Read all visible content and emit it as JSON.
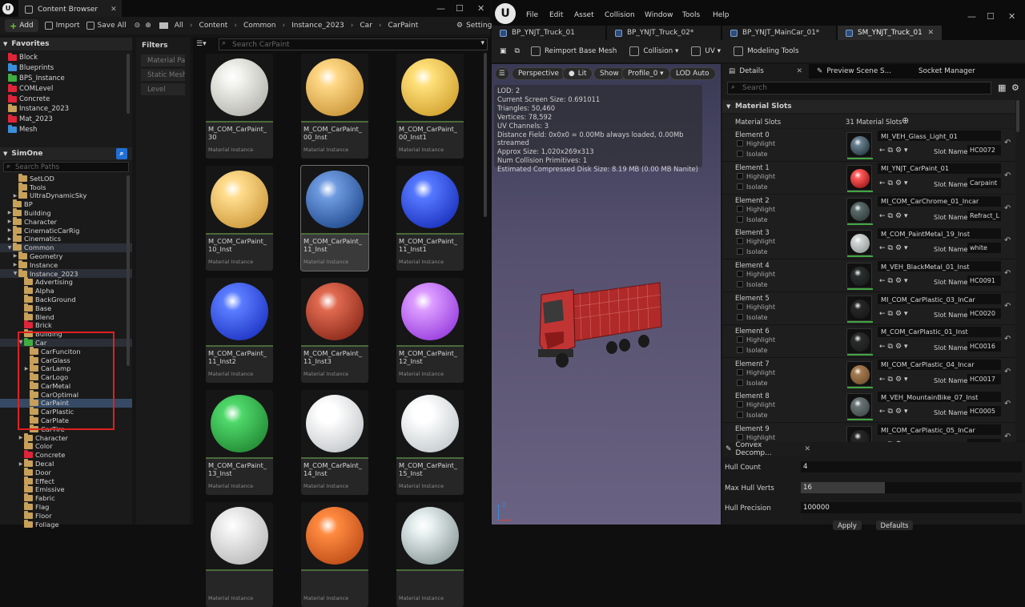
{
  "cb": {
    "title": "Content Browser",
    "add_label": "Add",
    "import_label": "Import",
    "saveall_label": "Save All",
    "settings_label": "Settings",
    "breadcrumb": [
      "All",
      "Content",
      "Common",
      "Instance_2023",
      "Car",
      "CarPaint"
    ],
    "favorites_header": "Favorites",
    "favorites": [
      {
        "label": "Block",
        "color": "#e0243a"
      },
      {
        "label": "Blueprints",
        "color": "#3b8ed8"
      },
      {
        "label": "BPS_Instance",
        "color": "#3fae3f"
      },
      {
        "label": "COMLevel",
        "color": "#e0243a"
      },
      {
        "label": "Concrete",
        "color": "#e0243a"
      },
      {
        "label": "Instance_2023",
        "color": "#c7a05a"
      },
      {
        "label": "Mat_2023",
        "color": "#e0243a"
      },
      {
        "label": "Mesh",
        "color": "#3b8ed8"
      }
    ],
    "tree_header": "SimOne",
    "search_paths": "Search Paths",
    "tree": [
      {
        "label": "SetLOD",
        "d": 3,
        "c": "#c7a05a"
      },
      {
        "label": "Tools",
        "d": 3,
        "c": "#c7a05a"
      },
      {
        "label": "UltraDynamicSky",
        "d": 3,
        "c": "#c7a05a",
        "a": "▶"
      },
      {
        "label": "BP",
        "d": 2,
        "c": "#c7a05a"
      },
      {
        "label": "Building",
        "d": 2,
        "c": "#c7a05a",
        "a": "▶"
      },
      {
        "label": "Character",
        "d": 2,
        "c": "#c7a05a",
        "a": "▶"
      },
      {
        "label": "CinematicCarRig",
        "d": 2,
        "c": "#c7a05a",
        "a": "▶"
      },
      {
        "label": "Cinematics",
        "d": 2,
        "c": "#c7a05a",
        "a": "▶"
      },
      {
        "label": "Common",
        "d": 2,
        "c": "#c7a05a",
        "a": "▼",
        "hl": true
      },
      {
        "label": "Geometry",
        "d": 3,
        "c": "#c7a05a",
        "a": "▶"
      },
      {
        "label": "Instance",
        "d": 3,
        "c": "#c7a05a",
        "a": "▶"
      },
      {
        "label": "Instance_2023",
        "d": 3,
        "c": "#c7a05a",
        "a": "▼",
        "hl": true
      },
      {
        "label": "Advertising",
        "d": 4,
        "c": "#c7a05a"
      },
      {
        "label": "Alpha",
        "d": 4,
        "c": "#c7a05a"
      },
      {
        "label": "BackGround",
        "d": 4,
        "c": "#c7a05a"
      },
      {
        "label": "Base",
        "d": 4,
        "c": "#c7a05a"
      },
      {
        "label": "Blend",
        "d": 4,
        "c": "#c7a05a"
      },
      {
        "label": "Brick",
        "d": 4,
        "c": "#e0243a"
      },
      {
        "label": "Building",
        "d": 4,
        "c": "#c7a05a"
      },
      {
        "label": "Car",
        "d": 4,
        "c": "#3fae3f",
        "a": "▼",
        "hl": true
      },
      {
        "label": "CarFunciton",
        "d": 5,
        "c": "#c7a05a"
      },
      {
        "label": "CarGlass",
        "d": 5,
        "c": "#c7a05a"
      },
      {
        "label": "CarLamp",
        "d": 5,
        "c": "#c7a05a",
        "a": "▶"
      },
      {
        "label": "CarLogo",
        "d": 5,
        "c": "#c7a05a"
      },
      {
        "label": "CarMetal",
        "d": 5,
        "c": "#c7a05a"
      },
      {
        "label": "CarOptimal",
        "d": 5,
        "c": "#c7a05a"
      },
      {
        "label": "CarPaint",
        "d": 5,
        "c": "#c7a05a",
        "sel": true
      },
      {
        "label": "CarPlastic",
        "d": 5,
        "c": "#c7a05a"
      },
      {
        "label": "CarPlate",
        "d": 5,
        "c": "#c7a05a"
      },
      {
        "label": "CarTire",
        "d": 5,
        "c": "#c7a05a"
      },
      {
        "label": "Character",
        "d": 4,
        "c": "#c7a05a",
        "a": "▶"
      },
      {
        "label": "Color",
        "d": 4,
        "c": "#c7a05a"
      },
      {
        "label": "Concrete",
        "d": 4,
        "c": "#e0243a"
      },
      {
        "label": "Decal",
        "d": 4,
        "c": "#c7a05a",
        "a": "▶"
      },
      {
        "label": "Door",
        "d": 4,
        "c": "#c7a05a"
      },
      {
        "label": "Effect",
        "d": 4,
        "c": "#c7a05a"
      },
      {
        "label": "Emissive",
        "d": 4,
        "c": "#c7a05a"
      },
      {
        "label": "Fabric",
        "d": 4,
        "c": "#c7a05a"
      },
      {
        "label": "Flag",
        "d": 4,
        "c": "#c7a05a"
      },
      {
        "label": "Floor",
        "d": 4,
        "c": "#c7a05a"
      },
      {
        "label": "Foliage",
        "d": 4,
        "c": "#c7a05a"
      }
    ],
    "filters_header": "Filters",
    "filter_chips": [
      "Material Pa",
      "Static Mesh",
      "Level"
    ],
    "grid_search": "Search CarPaint",
    "type_label": "Material Instance",
    "assets": [
      {
        "name": "M_COM_CarPaint_30",
        "c1": "#f2f2ee",
        "c2": "#a8a8a0"
      },
      {
        "name": "M_COM_CarPaint_00_Inst",
        "c1": "#ffd886",
        "c2": "#c08a2a"
      },
      {
        "name": "M_COM_CarPaint_00_Inst1",
        "c1": "#ffe07a",
        "c2": "#c89520"
      },
      {
        "name": "M_COM_CarPaint_10_Inst",
        "c1": "#ffdc8c",
        "c2": "#c48d2e"
      },
      {
        "name": "M_COM_CarPaint_11_Inst",
        "c1": "#6e9ae0",
        "c2": "#143d80",
        "sel": true
      },
      {
        "name": "M_COM_CarPaint_11_Inst1",
        "c1": "#5578ff",
        "c2": "#1024b0"
      },
      {
        "name": "M_COM_CarPaint_11_Inst2",
        "c1": "#5a7cff",
        "c2": "#1226b8"
      },
      {
        "name": "M_COM_CarPaint_11_Inst3",
        "c1": "#e06a50",
        "c2": "#7a1c10"
      },
      {
        "name": "M_COM_CarPaint_12_Inst",
        "c1": "#dc9cff",
        "c2": "#8a2ad8"
      },
      {
        "name": "M_COM_CarPaint_13_Inst",
        "c1": "#4fd86a",
        "c2": "#1a7a2a"
      },
      {
        "name": "M_COM_CarPaint_14_Inst",
        "c1": "#ffffff",
        "c2": "#b8bcc0"
      },
      {
        "name": "M_COM_CarPaint_15_Inst",
        "c1": "#ffffff",
        "c2": "#b8c0c4"
      },
      {
        "name": "",
        "c1": "#f0f0f0",
        "c2": "#b0b0b0"
      },
      {
        "name": "",
        "c1": "#ff8a40",
        "c2": "#b04010"
      },
      {
        "name": "",
        "c1": "#e8f0f0",
        "c2": "#7a8a8a"
      }
    ]
  },
  "editor": {
    "menus": [
      "File",
      "Edit",
      "Asset",
      "Collision",
      "Window",
      "Tools",
      "Help"
    ],
    "tabs": [
      "BP_YNJT_Truck_01",
      "BP_YNJT_Truck_02*",
      "BP_YNJT_MainCar_01*",
      "SM_YNJT_Truck_01"
    ],
    "toolbar": {
      "reimport": "Reimport Base Mesh",
      "collision": "Collision",
      "uv": "UV",
      "modeling": "Modeling Tools"
    },
    "viewport": {
      "perspective": "Perspective",
      "lit": "Lit",
      "show": "Show",
      "profile": "Profile_0",
      "lod_auto": "LOD Auto",
      "stats": [
        "LOD:  2",
        "Current Screen Size:  0.691011",
        "Triangles:  50,460",
        "Vertices:  78,592",
        "UV Channels:  3",
        "Distance Field:  0x0x0 = 0.00Mb always loaded, 0.00Mb streamed",
        "Approx Size: 1,020x269x313",
        "Num Collision Primitives:  1",
        "Estimated Compressed Disk Size: 8.19 MB (0.00 MB Nanite)"
      ]
    },
    "details": {
      "tabs": [
        "Details",
        "Preview Scene S...",
        "Socket Manager"
      ],
      "search": "Search",
      "section": "Material Slots",
      "slots_label": "Material Slots",
      "slots_count": "31 Material Slots",
      "highlight": "Highlight",
      "isolate": "Isolate",
      "slot_name_label": "Slot Name",
      "elements": [
        {
          "label": "Element 0",
          "mat": "MI_VEH_Glass_Light_01",
          "slot": "HC0072",
          "c1": "#6a8090",
          "c2": "#1a2a30"
        },
        {
          "label": "Element 1",
          "mat": "MI_YNJT_CarPaint_01",
          "slot": "Carpaint",
          "c1": "#ff5a5a",
          "c2": "#8a0a0a"
        },
        {
          "label": "Element 2",
          "mat": "MI_COM_CarChrome_01_Incar",
          "slot": "Refract_L",
          "c1": "#5a6a6a",
          "c2": "#2a3434"
        },
        {
          "label": "Element 3",
          "mat": "M_COM_PaintMetal_19_Inst",
          "slot": "white",
          "c1": "#d0d4d4",
          "c2": "#8a9090"
        },
        {
          "label": "Element 4",
          "mat": "M_VEH_BlackMetal_01_Inst",
          "slot": "HC0091",
          "c1": "#2a2e2e",
          "c2": "#161818"
        },
        {
          "label": "Element 5",
          "mat": "MI_COM_CarPlastic_03_InCar",
          "slot": "HC0020",
          "c1": "#262626",
          "c2": "#161616"
        },
        {
          "label": "Element 6",
          "mat": "M_COM_CarPlastic_01_Inst",
          "slot": "HC0016",
          "c1": "#2a2c2c",
          "c2": "#171818"
        },
        {
          "label": "Element 7",
          "mat": "MI_COM_CarPlastic_04_Incar",
          "slot": "HC0017",
          "c1": "#a47a50",
          "c2": "#6a4a2a"
        },
        {
          "label": "Element 8",
          "mat": "M_VEH_MountainBike_07_Inst",
          "slot": "HC0005",
          "c1": "#6a7474",
          "c2": "#3a4242"
        },
        {
          "label": "Element 9",
          "mat": "MI_COM_CarPlastic_05_InCar",
          "slot": "",
          "c1": "#262626",
          "c2": "#161616"
        }
      ]
    },
    "convex": {
      "title": "Convex Decomp...",
      "hull_count_label": "Hull Count",
      "hull_count": "4",
      "max_verts_label": "Max Hull Verts",
      "max_verts": "16",
      "max_verts_fill": 0.38,
      "precision_label": "Hull Precision",
      "precision": "100000",
      "apply": "Apply",
      "defaults": "Defaults"
    }
  }
}
